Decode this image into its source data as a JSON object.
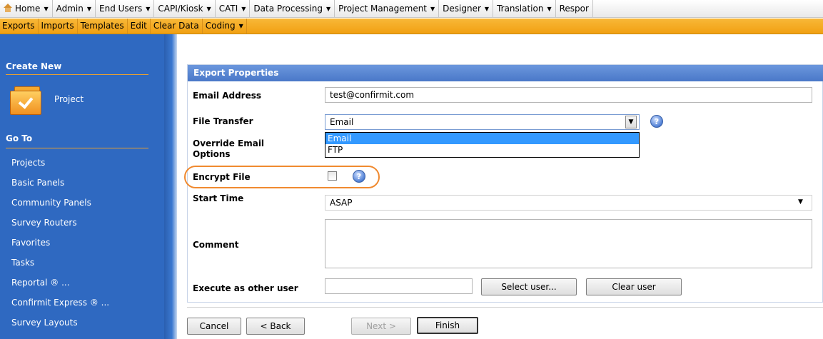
{
  "top_menu": {
    "items": [
      "Home",
      "Admin",
      "End Users",
      "CAPI/Kiosk",
      "CATI",
      "Data Processing",
      "Project Management",
      "Designer",
      "Translation",
      "Respor"
    ]
  },
  "sub_menu": {
    "items": [
      "Exports",
      "Imports",
      "Templates",
      "Edit",
      "Clear Data",
      "Coding"
    ]
  },
  "sidebar": {
    "create_new_heading": "Create New",
    "project_label": "Project",
    "go_to_heading": "Go To",
    "links": [
      "Projects",
      "Basic Panels",
      "Community Panels",
      "Survey Routers",
      "Favorites",
      "Tasks",
      "Reportal ® ...",
      "Confirmit Express ® ...",
      "Survey Layouts"
    ]
  },
  "panel": {
    "title": "Export Properties",
    "email_label": "Email Address",
    "email_value": "test@confirmit.com",
    "file_transfer_label": "File Transfer",
    "file_transfer_value": "Email",
    "file_transfer_options": [
      "Email",
      "FTP"
    ],
    "override_label_line1": "Override Email",
    "override_label_line2": "Options",
    "encrypt_label": "Encrypt File",
    "encrypt_checked": false,
    "start_time_label": "Start Time",
    "start_time_value": "ASAP",
    "comment_label": "Comment",
    "comment_value": "",
    "execute_label": "Execute as other user",
    "execute_value": "",
    "select_user_button": "Select user...",
    "clear_user_button": "Clear user"
  },
  "wizard_buttons": {
    "cancel": "Cancel",
    "back": "< Back",
    "next": "Next >",
    "finish": "Finish"
  },
  "colors": {
    "sidebar": "#2f69c1",
    "submenu": "#f1a012",
    "panel_header": "#4a78c8",
    "highlight": "#f08a30",
    "selected_option": "#3399ff"
  }
}
